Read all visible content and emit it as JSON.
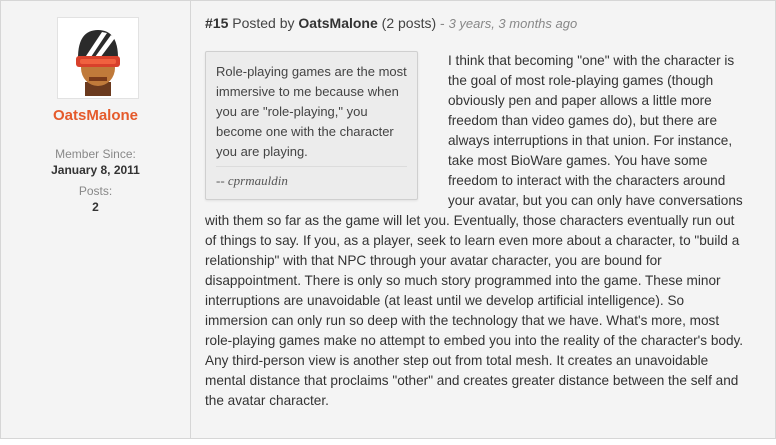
{
  "sidebar": {
    "username": "OatsMalone",
    "member_since_label": "Member Since:",
    "member_since_date": "January 8, 2011",
    "posts_label": "Posts:",
    "posts_count": "2",
    "avatar_icon": "helmet-avatar-icon",
    "username_color": "#e55a2b"
  },
  "post": {
    "number": "#15",
    "posted_by_label": "Posted by",
    "author": "OatsMalone",
    "author_posts": "(2 posts)",
    "separator": "-",
    "time_ago": "3 years, 3 months ago",
    "quote": {
      "text": "Role-playing games are the most immersive to me because when you are \"role-playing,\" you become one with the character you are playing.",
      "attribution": "-- cprmauldin"
    },
    "body": "I think that becoming \"one\" with the character is the goal of most role-playing games (though obviously pen and paper allows a little more freedom than video games do), but there are always interruptions in that union. For instance, take most BioWare games. You have some freedom to interact with the characters around your avatar, but you can only have conversations with them so far as the game will let you. Eventually, those characters eventually run out of things to say. If you, as a player, seek to learn even more about a character, to \"build a relationship\" with that NPC through your avatar character, you are bound for disappointment. There is only so much story programmed into the game. These minor interruptions are unavoidable (at least until we develop artificial intelligence). So immersion can only run so deep with the technology that we have. What's more, most role-playing games make no attempt to embed you into the reality of the character's body. Any third-person view is another step out from total mesh. It creates an unavoidable mental distance that proclaims \"other\" and creates greater distance between the self and the avatar character."
  }
}
